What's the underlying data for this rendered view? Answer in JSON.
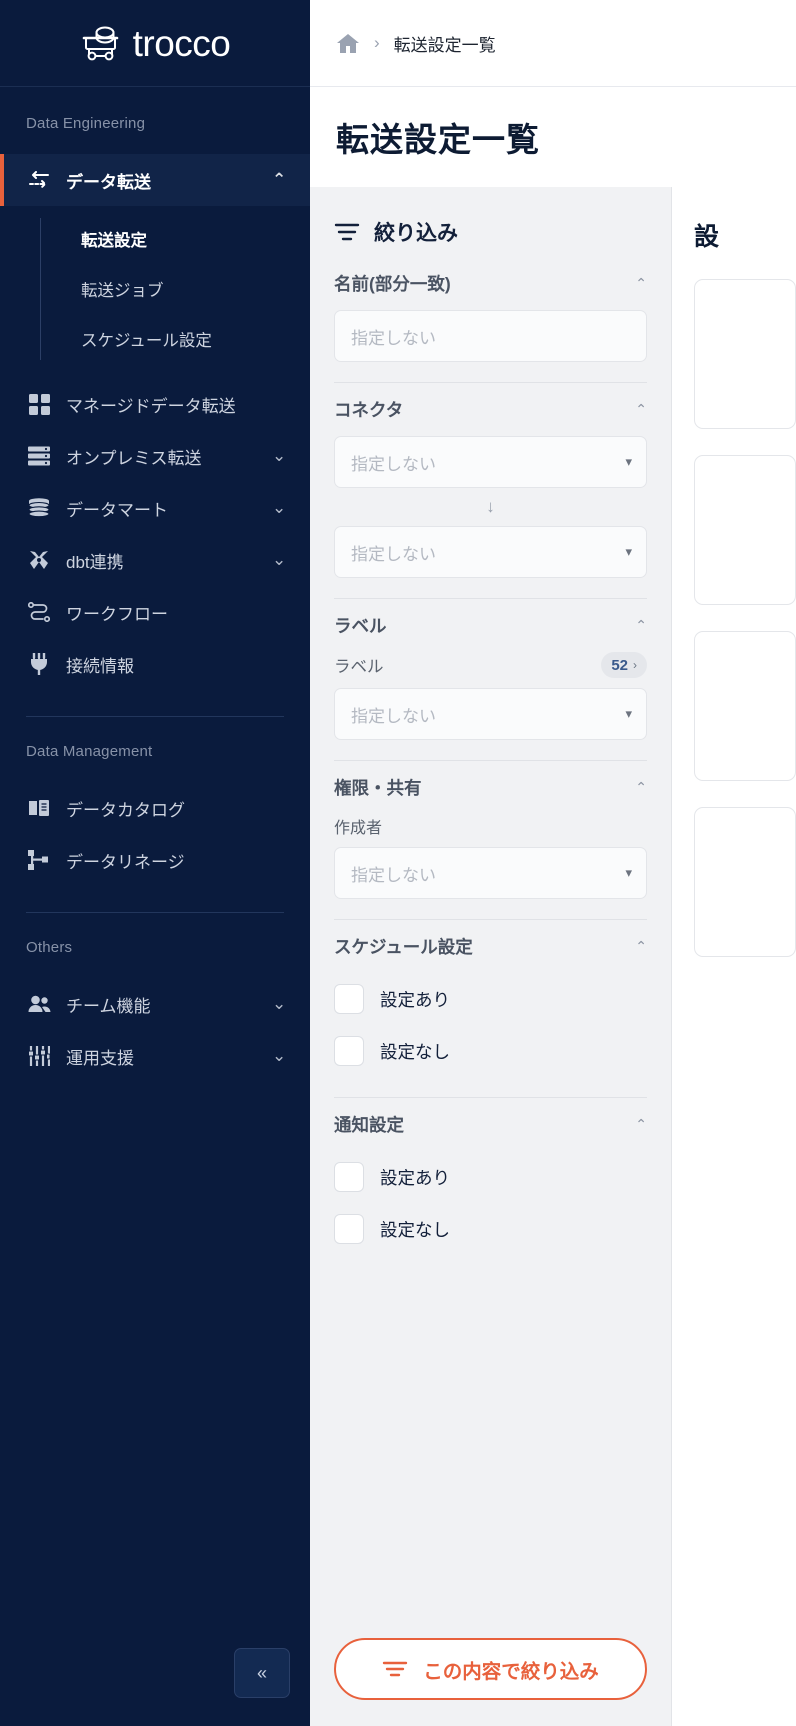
{
  "brand": {
    "name": "trocco",
    "logo_icon": "trocco-cart-icon",
    "accent": "#e8613c",
    "sidebar_bg": "#0a1b3d"
  },
  "sidebar": {
    "sections": [
      {
        "label": "Data Engineering",
        "items": [
          {
            "icon": "data-transfer-icon",
            "label": "データ転送",
            "chev": "⌃",
            "active": true,
            "children": [
              {
                "label": "転送設定",
                "current": true
              },
              {
                "label": "転送ジョブ",
                "current": false
              },
              {
                "label": "スケジュール設定",
                "current": false
              }
            ]
          },
          {
            "icon": "grid-icon",
            "label": "マネージドデータ転送",
            "chev": ""
          },
          {
            "icon": "server-icon",
            "label": "オンプレミス転送",
            "chev": "⌄"
          },
          {
            "icon": "database-icon",
            "label": "データマート",
            "chev": "⌄"
          },
          {
            "icon": "dbt-icon",
            "label": "dbt連携",
            "chev": "⌄"
          },
          {
            "icon": "workflow-icon",
            "label": "ワークフロー",
            "chev": ""
          },
          {
            "icon": "plug-icon",
            "label": "接続情報",
            "chev": ""
          }
        ]
      },
      {
        "label": "Data Management",
        "items": [
          {
            "icon": "book-icon",
            "label": "データカタログ",
            "chev": ""
          },
          {
            "icon": "lineage-icon",
            "label": "データリネージ",
            "chev": ""
          }
        ]
      },
      {
        "label": "Others",
        "items": [
          {
            "icon": "people-icon",
            "label": "チーム機能",
            "chev": "⌄"
          },
          {
            "icon": "sliders-icon",
            "label": "運用支援",
            "chev": "⌄"
          }
        ]
      }
    ],
    "collapse_button": {
      "icon": "double-chevron-left-icon",
      "glyph": "«"
    }
  },
  "breadcrumb": {
    "home_icon": "home-icon",
    "separator": "›",
    "current": "転送設定一覧"
  },
  "page": {
    "title": "転送設定一覧"
  },
  "filter": {
    "header": {
      "icon": "filter-icon",
      "title": "絞り込み"
    },
    "name_group": {
      "title": "名前(部分一致)",
      "chev": "⌃",
      "input_placeholder": "指定しない",
      "input_value": ""
    },
    "connector_group": {
      "title": "コネクタ",
      "chev": "⌃",
      "source_placeholder": "指定しない",
      "arrow": "↓",
      "destination_placeholder": "指定しない"
    },
    "label_group": {
      "title": "ラベル",
      "chev": "⌃",
      "row_label": "ラベル",
      "count": "52",
      "count_chev": "›",
      "select_placeholder": "指定しない"
    },
    "permission_group": {
      "title": "権限・共有",
      "chev": "⌃",
      "creator_label": "作成者",
      "creator_placeholder": "指定しない"
    },
    "schedule_group": {
      "title": "スケジュール設定",
      "chev": "⌃",
      "options": [
        {
          "label": "設定あり",
          "checked": false
        },
        {
          "label": "設定なし",
          "checked": false
        }
      ]
    },
    "notification_group": {
      "title": "通知設定",
      "chev": "⌃",
      "options": [
        {
          "label": "設定あり",
          "checked": false
        },
        {
          "label": "設定なし",
          "checked": false
        }
      ]
    },
    "apply_button": {
      "icon": "filter-icon",
      "label": "この内容で絞り込み"
    }
  },
  "right_panel": {
    "title": "設"
  }
}
